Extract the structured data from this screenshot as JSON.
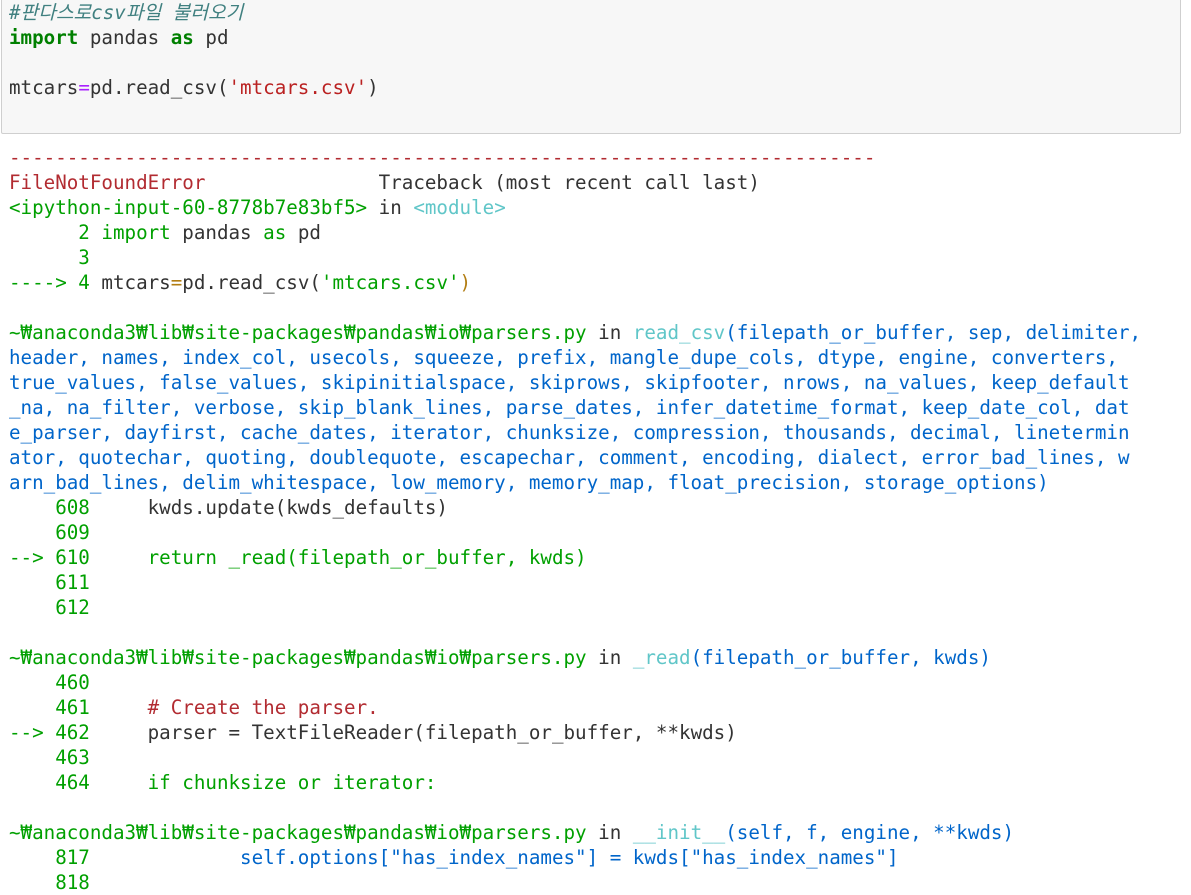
{
  "cell": {
    "comment": "#판다스로csv파일 불러오기",
    "line1": {
      "kw1": "import",
      "mod": " pandas ",
      "kw2": "as",
      "alias": " pd"
    },
    "line2": {
      "var": "mtcars",
      "op": "=",
      "call": "pd.read_csv(",
      "arg": "'mtcars.csv'",
      "close": ")"
    }
  },
  "traceback": {
    "dashes": "---------------------------------------------------------------------------",
    "error_name": "FileNotFoundError",
    "header": "Traceback (most recent call last)",
    "input_loc": "<ipython-input-60-8778b7e83bf5>",
    "in_word": " in ",
    "module": "<module>",
    "frame1": [
      {
        "num": "      2 ",
        "code1": "import",
        "code2": " pandas ",
        "code3": "as",
        "code4": " pd"
      },
      {
        "num": "      3",
        "code1": "",
        "code2": "",
        "code3": "",
        "code4": ""
      }
    ],
    "frame1_arrow": {
      "arrow": "----> 4 ",
      "code": "mtcars",
      "eq": "=",
      "call": "pd.read_csv(",
      "arg": "'mtcars.csv'",
      "close": ")"
    },
    "path": "~₩anaconda3₩lib₩site-packages₩pandas₩io₩parsers.py",
    "frame2_func": "read_csv",
    "frame2_sig_lines": [
      "(filepath_or_buffer, sep, delimiter,",
      "header, names, index_col, usecols, squeeze, prefix, mangle_dupe_cols, dtype, engine, converters,",
      "true_values, false_values, skipinitialspace, skiprows, skipfooter, nrows, na_values, keep_default",
      "_na, na_filter, verbose, skip_blank_lines, parse_dates, infer_datetime_format, keep_date_col, dat",
      "e_parser, dayfirst, cache_dates, iterator, chunksize, compression, thousands, decimal, linetermin",
      "ator, quotechar, quoting, doublequote, escapechar, comment, encoding, dialect, error_bad_lines, w",
      "arn_bad_lines, delim_whitespace, low_memory, memory_map, float_precision, storage_options)"
    ],
    "frame2_lines": [
      {
        "num": "    608 ",
        "code": "    kwds.update(kwds_defaults)"
      },
      {
        "num": "    609",
        "code": ""
      },
      {
        "num": "--> 610 ",
        "code": "    return _read(filepath_or_buffer, kwds)",
        "arrow": true
      },
      {
        "num": "    611",
        "code": ""
      },
      {
        "num": "    612",
        "code": ""
      }
    ],
    "frame3_func": "_read",
    "frame3_sig": "(filepath_or_buffer, kwds)",
    "frame3_lines": [
      {
        "num": "    460",
        "code": ""
      },
      {
        "num": "    461 ",
        "code": "    # Create the parser."
      },
      {
        "num": "--> 462 ",
        "code": "    parser = TextFileReader(filepath_or_buffer, **kwds)",
        "arrow": true
      },
      {
        "num": "    463",
        "code": ""
      },
      {
        "num": "    464 ",
        "code": "    if chunksize or iterator:"
      }
    ],
    "frame4_func": "__init__",
    "frame4_sig": "(self, f, engine, **kwds)",
    "frame4_lines": [
      {
        "num": "    817 ",
        "code": "            self.options[\"has_index_names\"] = kwds[\"has_index_names\"]"
      },
      {
        "num": "    818",
        "code": ""
      }
    ]
  }
}
